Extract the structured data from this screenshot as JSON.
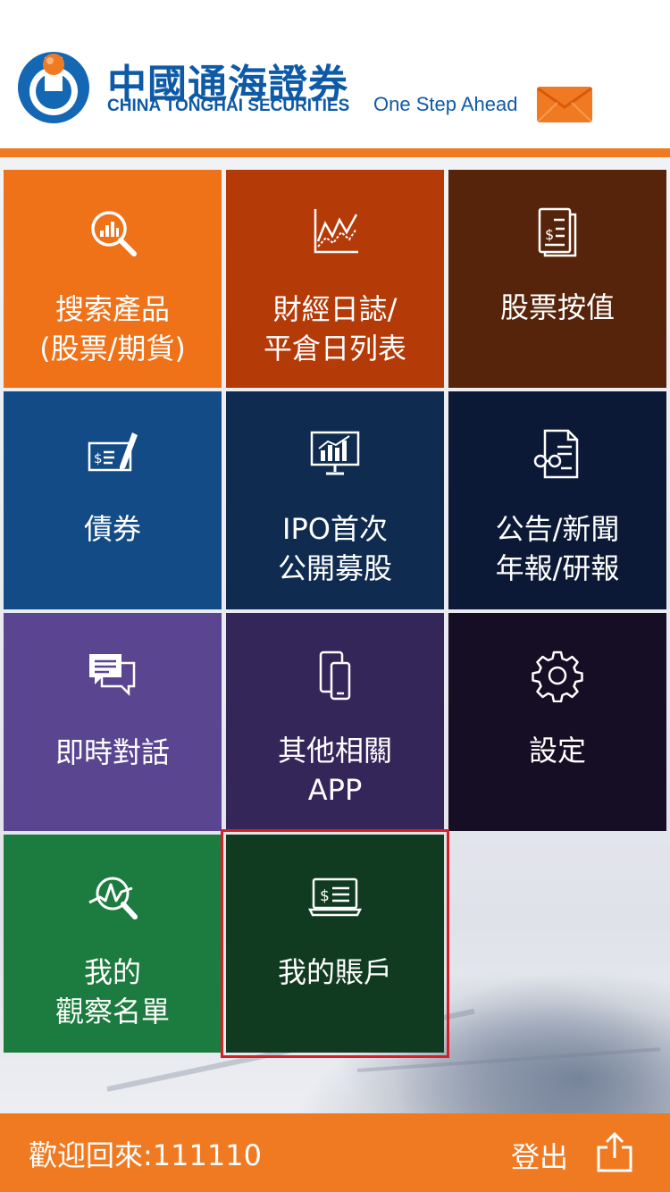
{
  "header": {
    "brand_cn": "中國通海證券",
    "brand_en": "CHINA TONGHAI SECURITIES",
    "tagline": "One Step Ahead",
    "mail_icon": "mail-icon",
    "accent_color": "#f07a22",
    "brand_color": "#0e5aa7"
  },
  "menu": {
    "tiles": [
      {
        "label": "搜索產品\n(股票/期貨)",
        "icon": "search-chart-icon",
        "color": "#ef7118"
      },
      {
        "label": "財經日誌/\n平倉日列表",
        "icon": "line-chart-icon",
        "color": "#b43a08"
      },
      {
        "label": "股票按值",
        "icon": "dollar-document-icon",
        "color": "#56240a"
      },
      {
        "label": "債券",
        "icon": "cheque-pen-icon",
        "color": "#134b86"
      },
      {
        "label": "IPO首次\n公開募股",
        "icon": "monitor-chart-icon",
        "color": "#0f2c50"
      },
      {
        "label": "公告/新聞\n年報/研報",
        "icon": "document-glasses-icon",
        "color": "#0b1936"
      },
      {
        "label": "即時對話",
        "icon": "chat-bubbles-icon",
        "color": "#5a4590"
      },
      {
        "label": "其他相關\nAPP",
        "icon": "mobile-devices-icon",
        "color": "#35265a"
      },
      {
        "label": "設定",
        "icon": "gear-icon",
        "color": "#150e24"
      },
      {
        "label": "我的\n觀察名單",
        "icon": "watchlist-icon",
        "color": "#1c7b3e"
      },
      {
        "label": "我的賬戶",
        "icon": "laptop-dollar-icon",
        "color": "#113b21"
      }
    ]
  },
  "footer": {
    "welcome": "歡迎回來:111110",
    "logout_label": "登出",
    "logout_icon": "share-icon",
    "bar_color": "#f07a22"
  },
  "selection_color": "#d71f2a"
}
